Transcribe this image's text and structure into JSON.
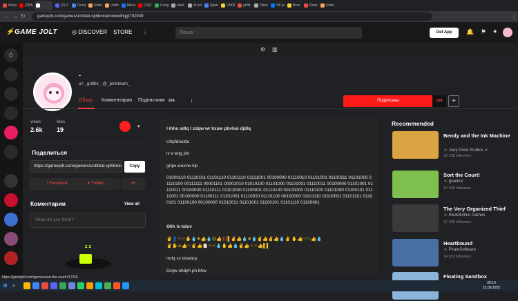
{
  "browser": {
    "tabs": [
      {
        "label": "Искус",
        "color": "#e74c3c"
      },
      {
        "label": "(259)",
        "color": "#ff0000"
      },
      {
        "label": "",
        "color": "#ffffff",
        "active": true
      },
      {
        "label": "(2) D",
        "color": "#5865f2"
      },
      {
        "label": "Генер",
        "color": "#4285f4"
      },
      {
        "label": "Unde",
        "color": "#f4a261"
      },
      {
        "label": "Unde",
        "color": "#f4a261"
      },
      {
        "label": "Messi",
        "color": "#1877f2"
      },
      {
        "label": "(14) I",
        "color": "#ff0000"
      },
      {
        "label": "Goog",
        "color": "#34a853"
      },
      {
        "label": "stark",
        "color": "#aaaaaa"
      },
      {
        "label": "#Luck",
        "color": "#aaaaaa"
      },
      {
        "label": "Span",
        "color": "#4285f4"
      },
      {
        "label": "UNDE",
        "color": "#f4d03f"
      },
      {
        "label": "grillb",
        "color": "#e74c3c"
      },
      {
        "label": "Прое",
        "color": "#aaaaaa"
      },
      {
        "label": "VK.ко",
        "color": "#0077ff"
      },
      {
        "label": "Всег",
        "color": "#f4d03f"
      },
      {
        "label": "Rewri",
        "color": "#e74c3c"
      },
      {
        "label": "Unde",
        "color": "#f4a261"
      }
    ],
    "url": "gamejolt.com/games/untitled-vphbnxuohowvdhqg/792939",
    "status_url": "https://gamejolt.com/games/sort-the-court/117326"
  },
  "header": {
    "logo": "GAME JOLT",
    "nav_discover": "DISCOVER",
    "nav_store": "STORE",
    "search_placeholder": "Поиск",
    "get_app": "Get App"
  },
  "profile": {
    "name": "-",
    "byline": "от _grillbz_ @_pinkteam_",
    "tabs": {
      "overview": "Обзор",
      "comments": "Комментарии",
      "followers": "Подписчики",
      "followers_count": "104"
    },
    "subscribed": "Подписаны",
    "subscribed_count": "104",
    "plus": "+"
  },
  "stats": {
    "views_label": "views",
    "views_value": "2.6k",
    "likes_label": "likes",
    "likes_value": "19"
  },
  "share": {
    "title": "Поделиться",
    "url": "https://gamejolt.com/games/untitled-vphbnxuohowvdhqg",
    "copy": "Copy",
    "facebook": "Facebook",
    "twitter": "Twitter",
    "more": "•••"
  },
  "comments": {
    "title": "Коментарии",
    "view_all": "View all",
    "placeholder": "What do you think?"
  },
  "post": {
    "heading": "l ihho sdlq l zdqw wr kxuw pbvhoi djdlq",
    "line1": "Uhpfdooldu",
    "line2": "lv d edg jxb",
    "line3": "grqw wuxvw klp",
    "binary": "01000110 01110101 01101110 01101110 01111001 00100000 01110010 01101001 01100111 01101000 01110100 00111111 00001101 00001010 01010100 01101000 01101001 01110011 00100000 01101001 01110011 00100000 01110111 01101000 01100001 01110100 00100000 01110100 01101000 01100101 01111001 00100000 01100111 01101001 01110010 01101100 00100000 01101110 01100001 01101101 01100101 01100100 00100000 01010011 01101001 01100101 01101110 01100001",
    "heading2": "Olih lv kduv",
    "emoji1": "✌👖☜☞✋💧❄👍💧☹👍💢▌✌👍💧❄💧✌👍✌👍💧✌ ✋👍☜☞👍💧",
    "emoji2": "✌✋☠👍☜✌👍📋☜☞💧✋👍💧✌👍☜☞👍▌▌",
    "line4": "mrlq xv duwbrp.",
    "line5": "Grqw ohdyh ph bhw"
  },
  "recommended": {
    "title": "Recommended",
    "items": [
      {
        "title": "Bendy and the Ink Machine",
        "dev": "Joey Drew Studios",
        "followers": "32 228 followers",
        "color": "#d9a441"
      },
      {
        "title": "Sort the Court!",
        "dev": "graebor",
        "followers": "10 596 followers",
        "color": "#7fbf4d"
      },
      {
        "title": "The Very Organized Thief",
        "dev": "Redefinition Games",
        "followers": "17 296 followers",
        "color": "#3a3a3a"
      },
      {
        "title": "Heartbound",
        "dev": "PirateSoftware",
        "followers": "14 623 followers",
        "color": "#4a6fa5"
      },
      {
        "title": "Floating Sandbox",
        "dev": "",
        "followers": "",
        "color": "#8ab4d9"
      }
    ]
  },
  "taskbar": {
    "time": "20:10",
    "date": "22.09.2025"
  }
}
